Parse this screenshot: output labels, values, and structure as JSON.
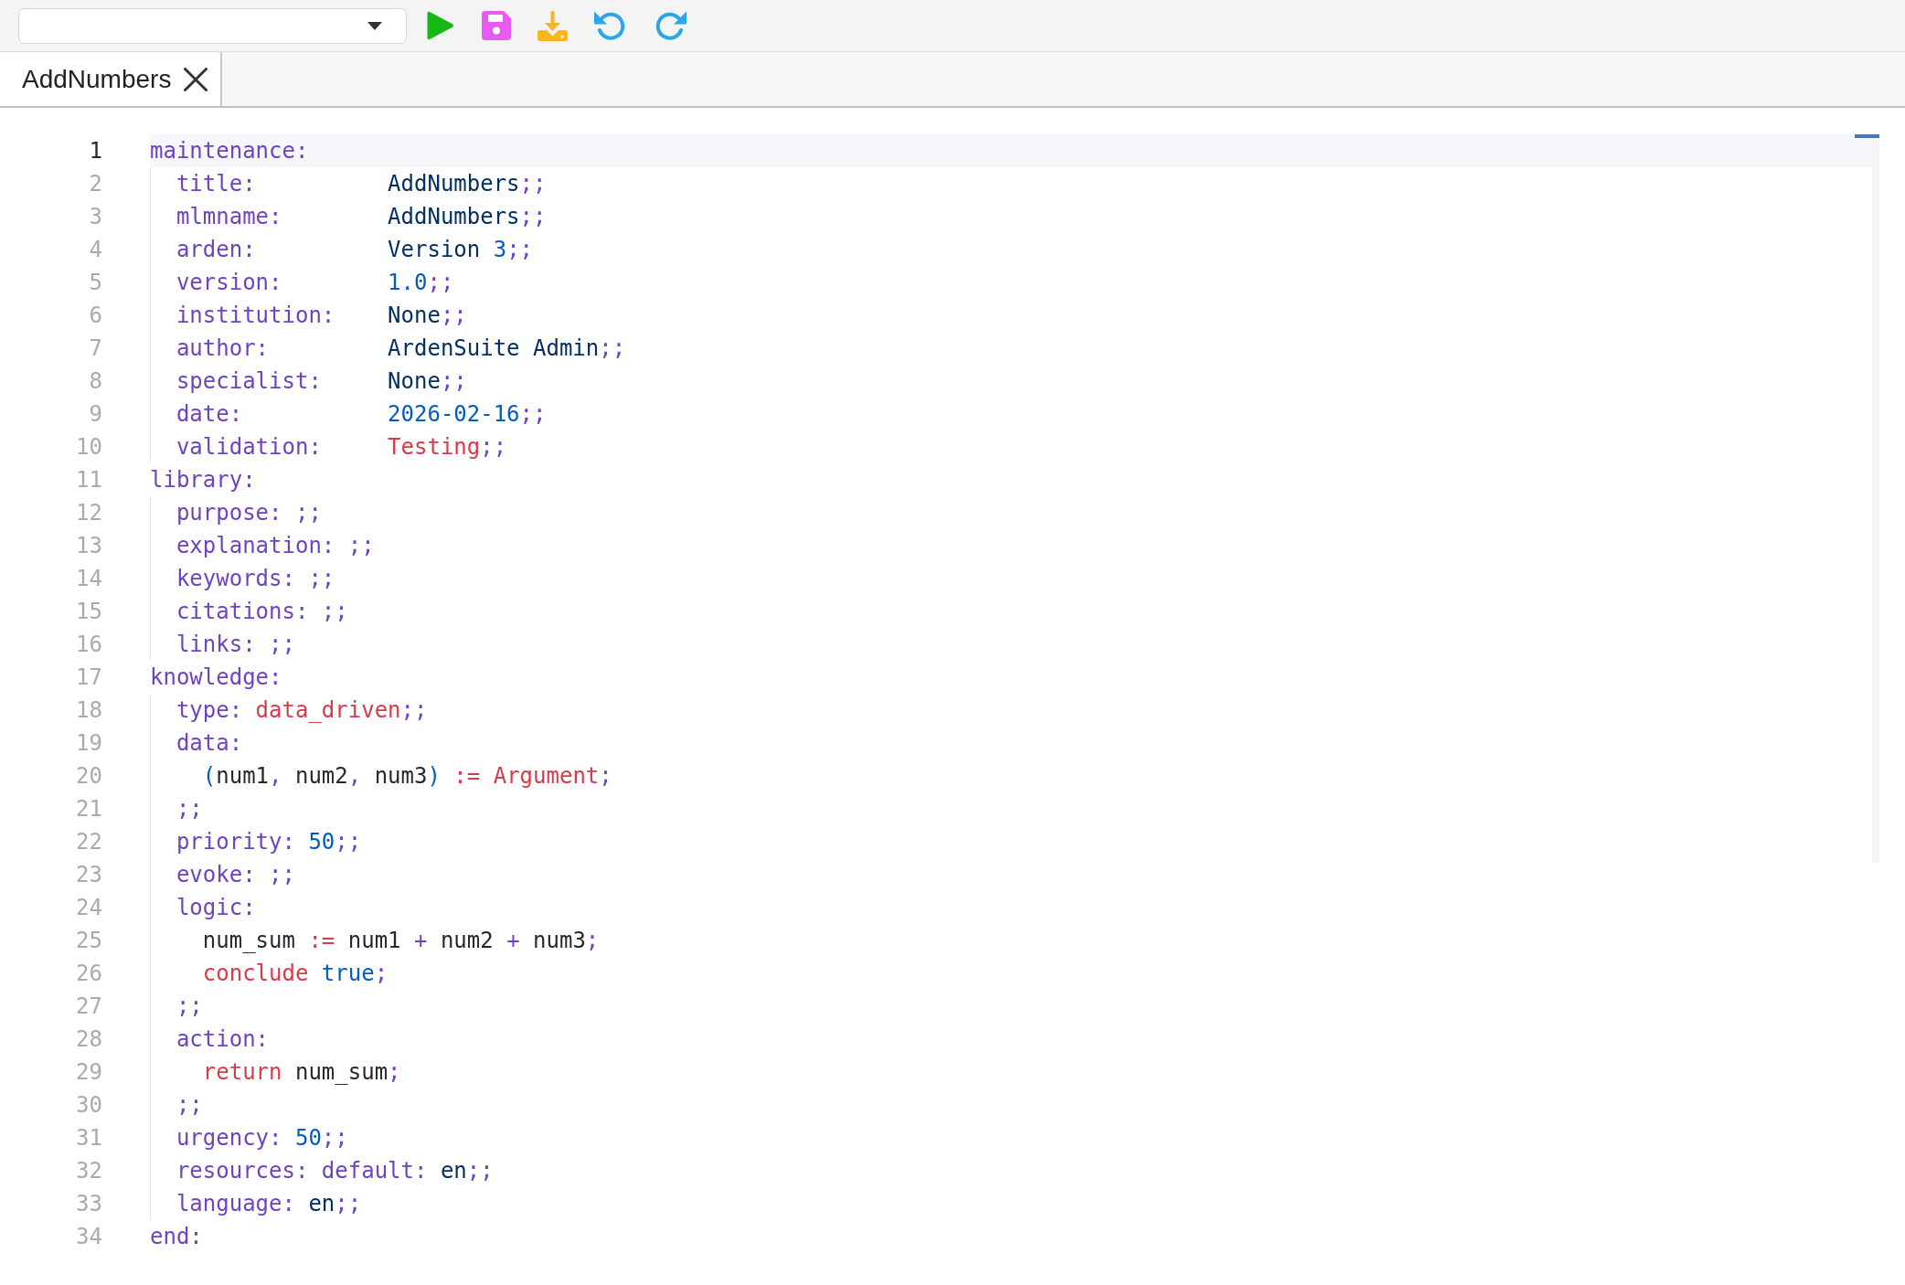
{
  "tabs": [
    {
      "label": "AddNumbers",
      "selected": true
    }
  ],
  "editor": {
    "lines": [
      {
        "number": "1",
        "active": true,
        "tokens": [
          {
            "kind": "keyword",
            "text": "maintenance:"
          }
        ],
        "children": [
          {
            "number": "2",
            "active": false,
            "tokens": [
              {
                "kind": "keyword",
                "text": "title:          "
              },
              {
                "kind": "value",
                "text": "AddNumbers"
              },
              {
                "kind": "keyword",
                "text": ";;"
              }
            ]
          },
          {
            "number": "3",
            "active": false,
            "tokens": [
              {
                "kind": "keyword",
                "text": "mlmname:        "
              },
              {
                "kind": "value",
                "text": "AddNumbers"
              },
              {
                "kind": "keyword",
                "text": ";;"
              }
            ]
          },
          {
            "number": "4",
            "active": false,
            "tokens": [
              {
                "kind": "keyword",
                "text": "arden:          "
              },
              {
                "kind": "value",
                "text": "Version "
              },
              {
                "kind": "literal",
                "text": "3"
              },
              {
                "kind": "keyword",
                "text": ";;"
              }
            ]
          },
          {
            "number": "5",
            "active": false,
            "tokens": [
              {
                "kind": "keyword",
                "text": "version:        "
              },
              {
                "kind": "literal",
                "text": "1.0"
              },
              {
                "kind": "keyword",
                "text": ";;"
              }
            ]
          },
          {
            "number": "6",
            "active": false,
            "tokens": [
              {
                "kind": "keyword",
                "text": "institution:    "
              },
              {
                "kind": "value",
                "text": "None"
              },
              {
                "kind": "keyword",
                "text": ";;"
              }
            ]
          },
          {
            "number": "7",
            "active": false,
            "tokens": [
              {
                "kind": "keyword",
                "text": "author:         "
              },
              {
                "kind": "value",
                "text": "ArdenSuite Admin"
              },
              {
                "kind": "keyword",
                "text": ";;"
              }
            ]
          },
          {
            "number": "8",
            "active": false,
            "tokens": [
              {
                "kind": "keyword",
                "text": "specialist:     "
              },
              {
                "kind": "value",
                "text": "None"
              },
              {
                "kind": "keyword",
                "text": ";;"
              }
            ]
          },
          {
            "number": "9",
            "active": false,
            "tokens": [
              {
                "kind": "keyword",
                "text": "date:           "
              },
              {
                "kind": "literal",
                "text": "2026-02-16"
              },
              {
                "kind": "keyword",
                "text": ";;"
              }
            ]
          },
          {
            "number": "10",
            "active": false,
            "tokens": [
              {
                "kind": "keyword",
                "text": "validation:     "
              },
              {
                "kind": "special",
                "text": "Testing"
              },
              {
                "kind": "keyword",
                "text": ";;"
              }
            ]
          }
        ]
      },
      {
        "number": "11",
        "active": false,
        "tokens": [
          {
            "kind": "keyword",
            "text": "library:"
          }
        ],
        "children": [
          {
            "number": "12",
            "active": false,
            "tokens": [
              {
                "kind": "keyword",
                "text": "purpose: ;;"
              }
            ]
          },
          {
            "number": "13",
            "active": false,
            "tokens": [
              {
                "kind": "keyword",
                "text": "explanation: ;;"
              }
            ]
          },
          {
            "number": "14",
            "active": false,
            "tokens": [
              {
                "kind": "keyword",
                "text": "keywords: ;;"
              }
            ]
          },
          {
            "number": "15",
            "active": false,
            "tokens": [
              {
                "kind": "keyword",
                "text": "citations: ;;"
              }
            ]
          },
          {
            "number": "16",
            "active": false,
            "tokens": [
              {
                "kind": "keyword",
                "text": "links: ;;"
              }
            ]
          }
        ]
      },
      {
        "number": "17",
        "active": false,
        "tokens": [
          {
            "kind": "keyword",
            "text": "knowledge:"
          }
        ],
        "children": [
          {
            "number": "18",
            "active": false,
            "tokens": [
              {
                "kind": "keyword",
                "text": "type: "
              },
              {
                "kind": "special",
                "text": "data_driven"
              },
              {
                "kind": "keyword",
                "text": ";;"
              }
            ]
          },
          {
            "number": "19",
            "active": false,
            "tokens": [
              {
                "kind": "keyword",
                "text": "data:"
              }
            ],
            "children": [
              {
                "number": "20",
                "active": false,
                "tokens": [
                  {
                    "kind": "literal",
                    "text": "("
                  },
                  {
                    "kind": "name",
                    "text": "num1"
                  },
                  {
                    "kind": "keyword",
                    "text": ", "
                  },
                  {
                    "kind": "name",
                    "text": "num2"
                  },
                  {
                    "kind": "keyword",
                    "text": ", "
                  },
                  {
                    "kind": "name",
                    "text": "num3"
                  },
                  {
                    "kind": "literal",
                    "text": ")"
                  },
                  {
                    "kind": "special",
                    "text": " := Argument"
                  },
                  {
                    "kind": "keyword",
                    "text": ";"
                  }
                ]
              }
            ]
          },
          {
            "number": "21",
            "active": false,
            "tokens": [
              {
                "kind": "keyword",
                "text": ";;"
              }
            ]
          },
          {
            "number": "22",
            "active": false,
            "tokens": [
              {
                "kind": "keyword",
                "text": "priority: "
              },
              {
                "kind": "literal",
                "text": "50"
              },
              {
                "kind": "keyword",
                "text": ";;"
              }
            ]
          },
          {
            "number": "23",
            "active": false,
            "tokens": [
              {
                "kind": "keyword",
                "text": "evoke: ;;"
              }
            ]
          },
          {
            "number": "24",
            "active": false,
            "tokens": [
              {
                "kind": "keyword",
                "text": "logic:"
              }
            ],
            "children": [
              {
                "number": "25",
                "active": false,
                "tokens": [
                  {
                    "kind": "name",
                    "text": "num_sum "
                  },
                  {
                    "kind": "special",
                    "text": ":="
                  },
                  {
                    "kind": "name",
                    "text": " num1 "
                  },
                  {
                    "kind": "keyword",
                    "text": "+"
                  },
                  {
                    "kind": "name",
                    "text": " num2 "
                  },
                  {
                    "kind": "keyword",
                    "text": "+"
                  },
                  {
                    "kind": "name",
                    "text": " num3"
                  },
                  {
                    "kind": "keyword",
                    "text": ";"
                  }
                ]
              },
              {
                "number": "26",
                "active": false,
                "tokens": [
                  {
                    "kind": "special",
                    "text": "conclude "
                  },
                  {
                    "kind": "literal",
                    "text": "true"
                  },
                  {
                    "kind": "keyword",
                    "text": ";"
                  }
                ]
              }
            ]
          },
          {
            "number": "27",
            "active": false,
            "tokens": [
              {
                "kind": "keyword",
                "text": ";;"
              }
            ]
          },
          {
            "number": "28",
            "active": false,
            "tokens": [
              {
                "kind": "keyword",
                "text": "action:"
              }
            ],
            "children": [
              {
                "number": "29",
                "active": false,
                "tokens": [
                  {
                    "kind": "special",
                    "text": "return "
                  },
                  {
                    "kind": "name",
                    "text": "num_sum"
                  },
                  {
                    "kind": "keyword",
                    "text": ";"
                  }
                ]
              }
            ]
          },
          {
            "number": "30",
            "active": false,
            "tokens": [
              {
                "kind": "keyword",
                "text": ";;"
              }
            ]
          },
          {
            "number": "31",
            "active": false,
            "tokens": [
              {
                "kind": "keyword",
                "text": "urgency: "
              },
              {
                "kind": "literal",
                "text": "50"
              },
              {
                "kind": "keyword",
                "text": ";;"
              }
            ]
          },
          {
            "number": "32",
            "active": false,
            "tokens": [
              {
                "kind": "keyword",
                "text": "resources: default: "
              },
              {
                "kind": "value",
                "text": "en"
              },
              {
                "kind": "keyword",
                "text": ";;"
              }
            ]
          },
          {
            "number": "33",
            "active": false,
            "tokens": [
              {
                "kind": "keyword",
                "text": "language: "
              },
              {
                "kind": "value",
                "text": "en"
              },
              {
                "kind": "keyword",
                "text": ";;"
              }
            ]
          }
        ]
      },
      {
        "number": "34",
        "active": false,
        "tokens": [
          {
            "kind": "keyword",
            "text": "end:"
          }
        ]
      }
    ]
  }
}
